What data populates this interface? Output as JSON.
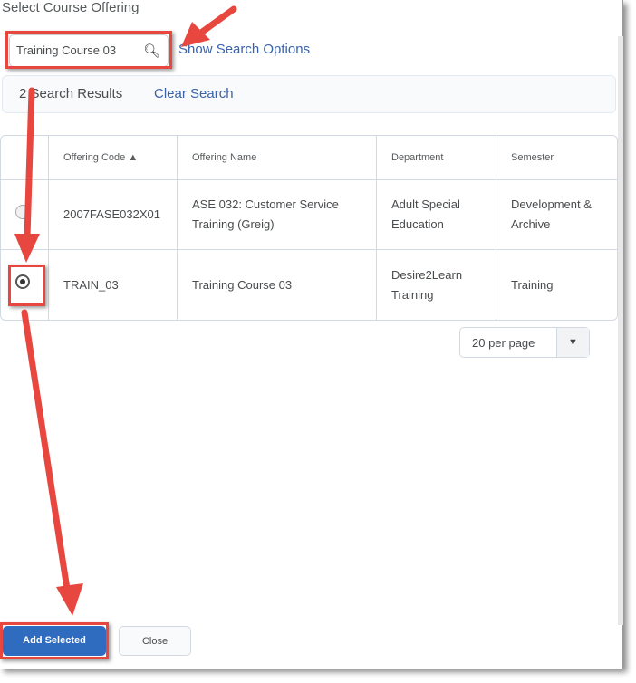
{
  "dialog": {
    "title": "Select Course Offering"
  },
  "search": {
    "value": "Training Course 03",
    "icon": "search-icon",
    "show_options": "Show Search Options"
  },
  "results": {
    "count_label": "2 Search Results",
    "clear": "Clear Search"
  },
  "table": {
    "headers": [
      "",
      "Offering Code",
      "Offering Name",
      "Department",
      "Semester"
    ],
    "sort_indicator": "▲",
    "rows": [
      {
        "selected": false,
        "code": "2007FASE032X01",
        "name": "ASE 032: Customer Service Training (Greig)",
        "department": "Adult Special Education",
        "semester": "Development & Archive"
      },
      {
        "selected": true,
        "code": "TRAIN_03",
        "name": "Training Course 03",
        "department": "Desire2Learn Training",
        "semester": "Training"
      }
    ]
  },
  "pagination": {
    "per_page": "20 per page"
  },
  "buttons": {
    "add": "Add Selected",
    "close": "Close"
  },
  "colors": {
    "annotation": "#e8473f",
    "primary": "#2f6bbf",
    "link": "#3a62a8"
  }
}
